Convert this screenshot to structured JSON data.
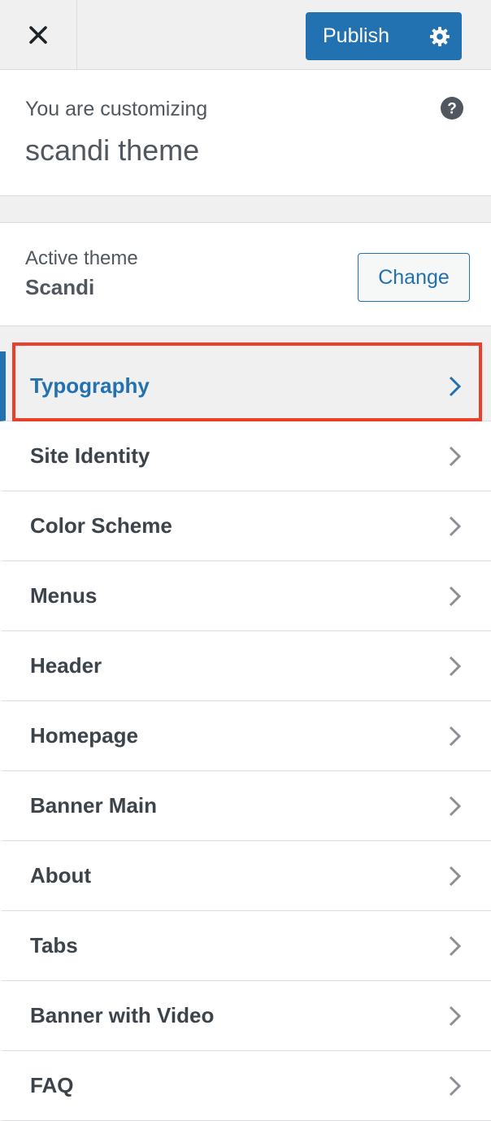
{
  "header": {
    "publish_label": "Publish",
    "icons": [
      "close-icon",
      "gear-icon"
    ]
  },
  "info": {
    "pre_title": "You are customizing",
    "title": "scandi theme",
    "icon": "help-icon"
  },
  "active_theme": {
    "label": "Active theme",
    "name": "Scandi",
    "change_label": "Change"
  },
  "menu": {
    "items": [
      {
        "label": "Typography",
        "active": true
      },
      {
        "label": "Site Identity"
      },
      {
        "label": "Color Scheme"
      },
      {
        "label": "Menus"
      },
      {
        "label": "Header"
      },
      {
        "label": "Homepage"
      },
      {
        "label": "Banner Main"
      },
      {
        "label": "About"
      },
      {
        "label": "Tabs"
      },
      {
        "label": "Banner with Video"
      },
      {
        "label": "FAQ"
      }
    ]
  },
  "colors": {
    "accent": "#2271b1",
    "highlight": "#e8402a",
    "background": "#f0f0f1"
  }
}
